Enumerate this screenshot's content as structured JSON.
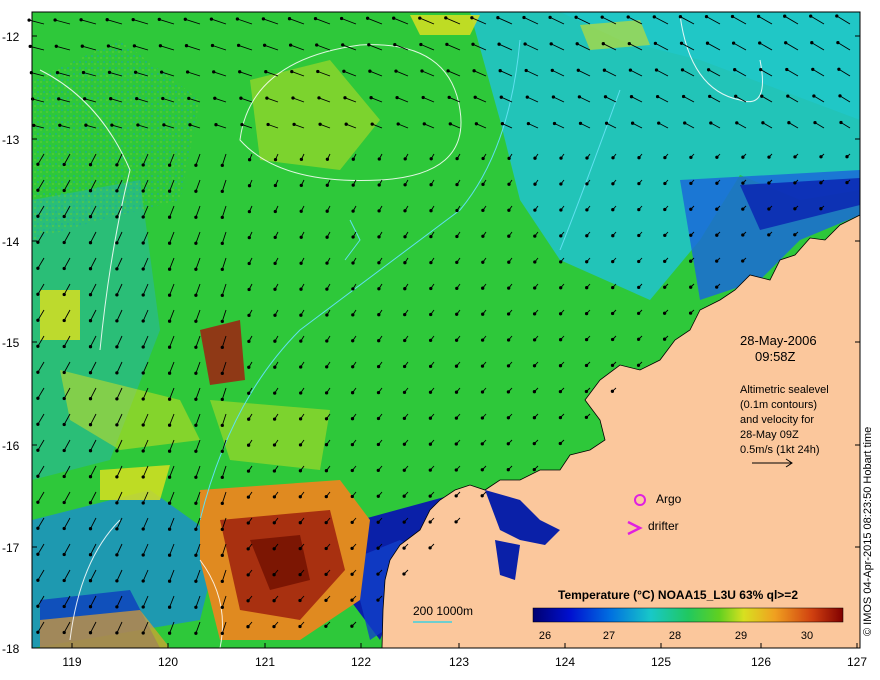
{
  "map": {
    "y_ticks": [
      "-12",
      "-13",
      "-14",
      "-15",
      "-16",
      "-17",
      "-18"
    ],
    "x_ticks": [
      "119",
      "120",
      "121",
      "122",
      "123",
      "124",
      "125",
      "126",
      "127"
    ],
    "lat_range": [
      -18,
      -11.8
    ],
    "lon_range": [
      118.6,
      127
    ],
    "date": "28-May-2006",
    "time": "09:58Z",
    "altimetry_text": "Altimetric sealevel\n(0.1m contours)\nand velocity for\n28-May 09Z\n0.5m/s (1kt 24h)",
    "argo_label": "Argo",
    "drifter_label": "drifter",
    "depth_legend": "200  1000m",
    "colorbar_title": "Temperature (°C) NOAA15_L3U 63% ql>=2",
    "colorbar_ticks": [
      "26",
      "27",
      "28",
      "29",
      "30"
    ],
    "colorbar_range": [
      25.8,
      30.7
    ],
    "credit": "© IMOS 04-Apr-2015 08:23:50 Hobart time",
    "colors": {
      "land": "#fbc79c",
      "ocean_green": "#2ec83a",
      "cyan": "#22c8c8",
      "warm_red": "#b02010",
      "argo_marker": "#e020e0",
      "drifter_marker": "#e020e0"
    }
  }
}
